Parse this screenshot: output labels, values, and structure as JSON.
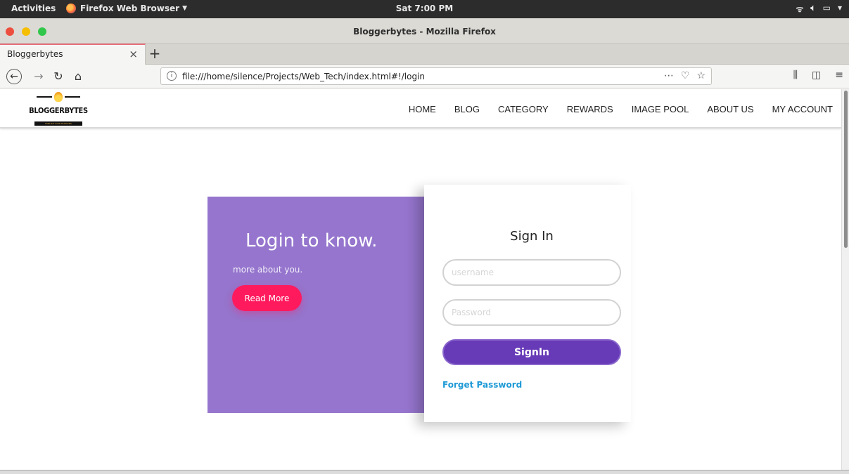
{
  "system_bar": {
    "activities": "Activities",
    "app_name": "Firefox Web Browser",
    "clock": "Sat  7:00 PM"
  },
  "window": {
    "title": "Bloggerbytes - Mozilla Firefox",
    "traffic_lights": [
      "#ed4f3e",
      "#f6be00",
      "#30c74a"
    ]
  },
  "tabs": [
    {
      "label": "Bloggerbytes",
      "active": true
    }
  ],
  "address_bar": {
    "url": "file:///home/silence/Projects/Web_Tech/index.html#!/login"
  },
  "site": {
    "logo": {
      "brand": "BLOGGERBYTES",
      "tagline": "PUBLISH YOUR PASSIONS"
    },
    "nav": [
      "HOME",
      "BLOG",
      "CATEGORY",
      "REWARDS",
      "IMAGE POOL",
      "ABOUT US",
      "MY ACCOUNT"
    ]
  },
  "login": {
    "headline": "Login to know.",
    "subtext": "more about you.",
    "read_more": "Read More",
    "title": "Sign In",
    "username_placeholder": "username",
    "password_placeholder": "Password",
    "signin_button": "SignIn",
    "forgot": "Forget Password"
  },
  "colors": {
    "panel_purple": "#9575cd",
    "read_more_pink": "#ff1a5e",
    "signin_purple": "#673ab7",
    "link_blue": "#1e9ad6"
  }
}
